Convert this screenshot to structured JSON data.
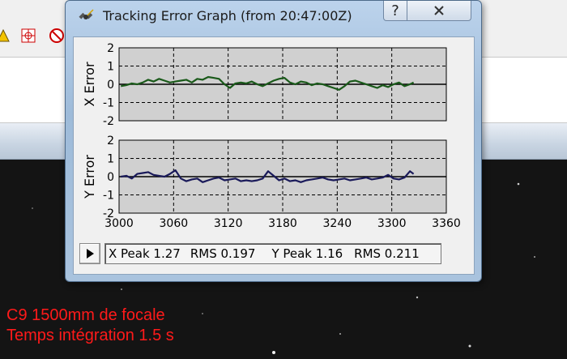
{
  "window": {
    "title": "Tracking Error Graph (from 20:47:00Z)",
    "help_label": "?"
  },
  "caption": {
    "line1": "C9 1500mm de focale",
    "line2": "Temps intégration 1.5 s"
  },
  "status": {
    "x_peak": "X Peak 1.27",
    "x_rms": "RMS 0.197",
    "y_peak": "Y Peak 1.16",
    "y_rms": "RMS 0.211"
  },
  "chart_data": [
    {
      "type": "line",
      "ylabel": "X Error",
      "xlim": [
        3000,
        3360
      ],
      "ylim": [
        -2,
        2
      ],
      "yticks": [
        "2",
        "1",
        "0",
        "-1",
        "-2"
      ],
      "grid": true,
      "color": "#1a5a1a",
      "series": [
        {
          "x": [
            3002,
            3008,
            3014,
            3020,
            3026,
            3032,
            3038,
            3044,
            3050,
            3056,
            3062,
            3068,
            3074,
            3080,
            3086,
            3092,
            3098,
            3104,
            3110,
            3116,
            3122,
            3128,
            3134,
            3140,
            3146,
            3152,
            3158,
            3164,
            3170,
            3176,
            3182,
            3188,
            3194,
            3200,
            3206,
            3212,
            3218,
            3224,
            3230,
            3236,
            3242,
            3248,
            3254,
            3260,
            3266,
            3272,
            3278,
            3284,
            3290,
            3296,
            3302,
            3308,
            3314,
            3320,
            3324
          ],
          "y": [
            -0.1,
            -0.05,
            0.05,
            0.0,
            0.1,
            0.25,
            0.15,
            0.3,
            0.2,
            0.1,
            0.15,
            0.2,
            0.25,
            0.1,
            0.3,
            0.25,
            0.4,
            0.35,
            0.3,
            0.0,
            -0.2,
            0.05,
            0.1,
            0.05,
            0.15,
            0.0,
            -0.1,
            0.05,
            0.2,
            0.3,
            0.35,
            0.1,
            0.0,
            0.15,
            0.1,
            -0.05,
            0.05,
            0.0,
            -0.1,
            -0.2,
            -0.3,
            -0.1,
            0.15,
            0.2,
            0.1,
            0.0,
            -0.1,
            -0.2,
            -0.05,
            -0.15,
            0.0,
            0.1,
            -0.1,
            0.0,
            0.1
          ]
        }
      ]
    },
    {
      "type": "line",
      "ylabel": "Y Error",
      "xlim": [
        3000,
        3360
      ],
      "xticks": [
        "3000",
        "3060",
        "3120",
        "3180",
        "3240",
        "3300",
        "3360"
      ],
      "ylim": [
        -2,
        2
      ],
      "yticks": [
        "2",
        "1",
        "0",
        "-1",
        "-2"
      ],
      "grid": true,
      "color": "#1a1a5a",
      "series": [
        {
          "x": [
            3002,
            3008,
            3014,
            3020,
            3026,
            3032,
            3038,
            3044,
            3050,
            3056,
            3062,
            3068,
            3074,
            3080,
            3086,
            3092,
            3098,
            3104,
            3110,
            3116,
            3122,
            3128,
            3134,
            3140,
            3146,
            3152,
            3158,
            3164,
            3170,
            3176,
            3182,
            3188,
            3194,
            3200,
            3206,
            3212,
            3218,
            3224,
            3230,
            3236,
            3242,
            3248,
            3254,
            3260,
            3266,
            3272,
            3278,
            3284,
            3290,
            3296,
            3302,
            3308,
            3314,
            3320,
            3324
          ],
          "y": [
            0.0,
            0.05,
            -0.1,
            0.15,
            0.2,
            0.25,
            0.1,
            0.05,
            0.0,
            0.15,
            0.35,
            -0.1,
            -0.25,
            -0.15,
            -0.1,
            -0.3,
            -0.2,
            -0.1,
            -0.05,
            -0.2,
            -0.15,
            -0.1,
            -0.25,
            -0.2,
            -0.25,
            -0.2,
            -0.1,
            0.3,
            0.05,
            -0.2,
            -0.1,
            -0.25,
            -0.2,
            -0.3,
            -0.2,
            -0.15,
            -0.1,
            -0.05,
            -0.15,
            -0.2,
            -0.15,
            -0.1,
            -0.2,
            -0.15,
            -0.1,
            -0.05,
            -0.15,
            -0.1,
            -0.05,
            0.1,
            -0.1,
            -0.15,
            -0.05,
            0.3,
            0.15
          ]
        }
      ]
    }
  ]
}
